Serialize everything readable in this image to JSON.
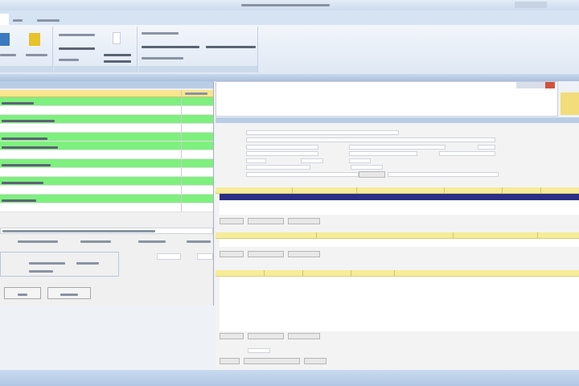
{
  "colors": {
    "accent": "#b9cde6",
    "row_highlight": "#7ef07e",
    "header": "#f8e58e",
    "selected_row": "#2b2f86"
  },
  "left_table": {
    "rows": [
      "g",
      "w",
      "g",
      "w",
      "g",
      "g",
      "w",
      "g",
      "w",
      "g",
      "w",
      "g",
      "w"
    ]
  },
  "icons": [
    "grid-icon",
    "folder-icon",
    "document-icon",
    "checkbox-icon"
  ]
}
